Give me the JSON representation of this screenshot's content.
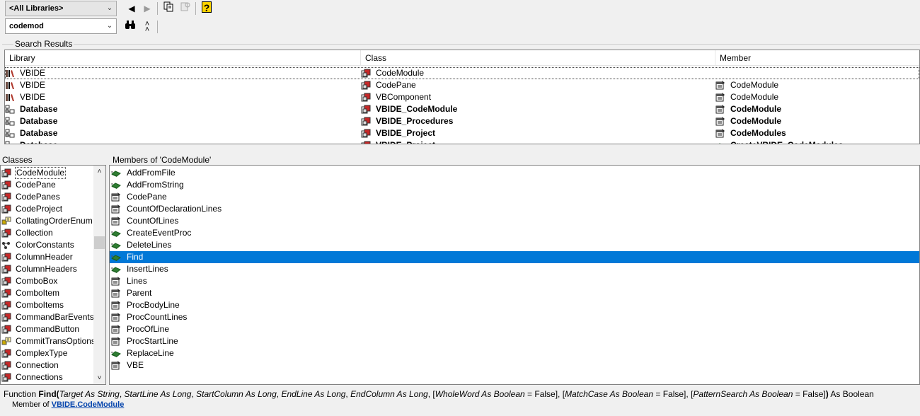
{
  "toolbar": {
    "library_combo": "<All Libraries>",
    "search_combo": "codemod"
  },
  "search_results": {
    "group_label": "Search Results",
    "columns": [
      "Library",
      "Class",
      "Member"
    ],
    "rows": [
      {
        "library": "VBIDE",
        "library_icon": "library-icon",
        "class": "CodeModule",
        "class_icon": "class-icon",
        "member": "",
        "member_icon": "",
        "bold": false
      },
      {
        "library": "VBIDE",
        "library_icon": "library-icon",
        "class": "CodePane",
        "class_icon": "class-icon",
        "member": "CodeModule",
        "member_icon": "property-icon",
        "bold": false
      },
      {
        "library": "VBIDE",
        "library_icon": "library-icon",
        "class": "VBComponent",
        "class_icon": "class-icon",
        "member": "CodeModule",
        "member_icon": "property-icon",
        "bold": false
      },
      {
        "library": "Database",
        "library_icon": "project-icon",
        "class": "VBIDE_CodeModule",
        "class_icon": "class-icon",
        "member": "CodeModule",
        "member_icon": "property-icon",
        "bold": true
      },
      {
        "library": "Database",
        "library_icon": "project-icon",
        "class": "VBIDE_Procedures",
        "class_icon": "class-icon",
        "member": "CodeModule",
        "member_icon": "property-icon",
        "bold": true
      },
      {
        "library": "Database",
        "library_icon": "project-icon",
        "class": "VBIDE_Project",
        "class_icon": "class-icon",
        "member": "CodeModules",
        "member_icon": "property-icon",
        "bold": true
      },
      {
        "library": "Database",
        "library_icon": "project-icon",
        "class": "VBIDE_Project",
        "class_icon": "class-icon",
        "member": "CreateVBIDE_CodeModules",
        "member_icon": "method-icon",
        "bold": true
      }
    ]
  },
  "classes": {
    "title": "Classes",
    "items": [
      {
        "label": "CodeModule",
        "icon": "class-icon",
        "selected": true
      },
      {
        "label": "CodePane",
        "icon": "class-icon"
      },
      {
        "label": "CodePanes",
        "icon": "class-icon"
      },
      {
        "label": "CodeProject",
        "icon": "class-icon"
      },
      {
        "label": "CollatingOrderEnum",
        "icon": "enum-icon"
      },
      {
        "label": "Collection",
        "icon": "class-icon"
      },
      {
        "label": "ColorConstants",
        "icon": "module-icon"
      },
      {
        "label": "ColumnHeader",
        "icon": "class-icon"
      },
      {
        "label": "ColumnHeaders",
        "icon": "class-icon"
      },
      {
        "label": "ComboBox",
        "icon": "class-icon"
      },
      {
        "label": "ComboItem",
        "icon": "class-icon"
      },
      {
        "label": "ComboItems",
        "icon": "class-icon"
      },
      {
        "label": "CommandBarEvents",
        "icon": "class-icon"
      },
      {
        "label": "CommandButton",
        "icon": "class-icon"
      },
      {
        "label": "CommitTransOptionsEnum",
        "icon": "enum-icon"
      },
      {
        "label": "ComplexType",
        "icon": "class-icon"
      },
      {
        "label": "Connection",
        "icon": "class-icon"
      },
      {
        "label": "Connections",
        "icon": "class-icon"
      }
    ]
  },
  "members": {
    "title": "Members of 'CodeModule'",
    "items": [
      {
        "label": "AddFromFile",
        "icon": "method-icon"
      },
      {
        "label": "AddFromString",
        "icon": "method-icon"
      },
      {
        "label": "CodePane",
        "icon": "property-icon"
      },
      {
        "label": "CountOfDeclarationLines",
        "icon": "property-icon"
      },
      {
        "label": "CountOfLines",
        "icon": "property-icon"
      },
      {
        "label": "CreateEventProc",
        "icon": "method-icon"
      },
      {
        "label": "DeleteLines",
        "icon": "method-icon"
      },
      {
        "label": "Find",
        "icon": "method-icon",
        "selected": true
      },
      {
        "label": "InsertLines",
        "icon": "method-icon"
      },
      {
        "label": "Lines",
        "icon": "property-icon"
      },
      {
        "label": "Parent",
        "icon": "property-icon"
      },
      {
        "label": "ProcBodyLine",
        "icon": "property-icon"
      },
      {
        "label": "ProcCountLines",
        "icon": "property-icon"
      },
      {
        "label": "ProcOfLine",
        "icon": "property-icon"
      },
      {
        "label": "ProcStartLine",
        "icon": "property-icon"
      },
      {
        "label": "ReplaceLine",
        "icon": "method-icon"
      },
      {
        "label": "VBE",
        "icon": "property-icon"
      }
    ]
  },
  "details": {
    "signature": {
      "kind": "Function ",
      "name": "Find(",
      "params": [
        {
          "name": "Target",
          "type": " As String",
          "sep": ", "
        },
        {
          "name": "StartLine",
          "type": " As Long",
          "sep": ", "
        },
        {
          "name": "StartColumn",
          "type": " As Long",
          "sep": ", "
        },
        {
          "name": "EndLine",
          "type": " As Long",
          "sep": ", "
        },
        {
          "name": "EndColumn",
          "type": " As Long",
          "sep": ", "
        },
        {
          "pre": "[",
          "name": "WholeWord",
          "type": " As Boolean",
          "post": " = False]",
          "sep": ", "
        },
        {
          "pre": "[",
          "name": "MatchCase",
          "type": " As Boolean",
          "post": " = False]",
          "sep": ", "
        },
        {
          "pre": "[",
          "name": "PatternSearch",
          "type": " As Boolean",
          "post": " = False]",
          "sep": ""
        }
      ],
      "close": ")",
      "returns": " As Boolean"
    },
    "member_of_prefix": "Member of ",
    "library_link": "VBIDE",
    "dot": ".",
    "class_link": "CodeModule"
  },
  "colors": {
    "selection": "#0078d7",
    "class_icon": "#c62828",
    "method_icon": "#2e7d32",
    "property_icon": "#555555",
    "library_icon": "#6d4c41",
    "enum_icon": "#c9a800"
  }
}
